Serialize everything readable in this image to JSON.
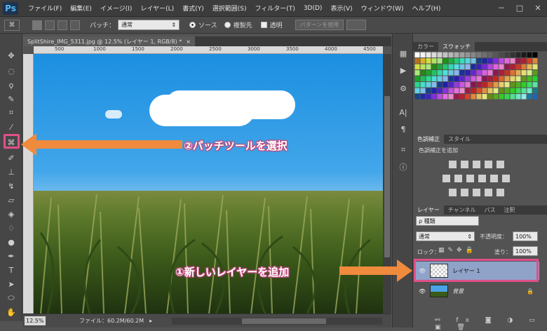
{
  "app": {
    "logo": "Ps"
  },
  "menu": [
    "ファイル(F)",
    "編集(E)",
    "イメージ(I)",
    "レイヤー(L)",
    "書式(Y)",
    "選択範囲(S)",
    "フィルター(T)",
    "3D(D)",
    "表示(V)",
    "ウィンドウ(W)",
    "ヘルプ(H)"
  ],
  "window_controls": [
    "－",
    "□",
    "✕"
  ],
  "options": {
    "patch_label": "パッチ：",
    "patch_value": "通常",
    "source_label": "ソース",
    "dest_label": "複製先",
    "transparent_label": "透明",
    "use_pattern_label": "パターンを使用"
  },
  "document": {
    "tab_title": "SplitShire_IMG_5311.jpg @ 12.5% (レイヤー 1, RGB/8) *",
    "ruler_marks": [
      "500",
      "1000",
      "1500",
      "2000",
      "2500",
      "3000",
      "3500",
      "4000",
      "4500"
    ]
  },
  "status": {
    "zoom": "12.5%",
    "file_info": "ファイル：60.2M/60.2M"
  },
  "panels": {
    "color_tabs": [
      "カラー",
      "スウォッチ"
    ],
    "adjust_tabs": [
      "色調補正",
      "スタイル"
    ],
    "adjust_title": "色調補正を追加",
    "layer_tabs": [
      "レイヤー",
      "チャンネル",
      "パス",
      "注釈"
    ],
    "kind_filter": "ρ 種類",
    "blend_mode": "通常",
    "opacity_label": "不透明度：",
    "opacity_value": "100%",
    "lock_label": "ロック：",
    "fill_label": "塗り：",
    "fill_value": "100%"
  },
  "layers": [
    {
      "name": "レイヤー 1",
      "selected": true
    },
    {
      "name": "背景",
      "selected": false,
      "locked": true
    }
  ],
  "annotations": {
    "tool_note": "②パッチツールを選択",
    "layer_note": "①新しいレイヤーを追加",
    "color": "#e0508a",
    "arrow_color": "#f08a3c"
  }
}
